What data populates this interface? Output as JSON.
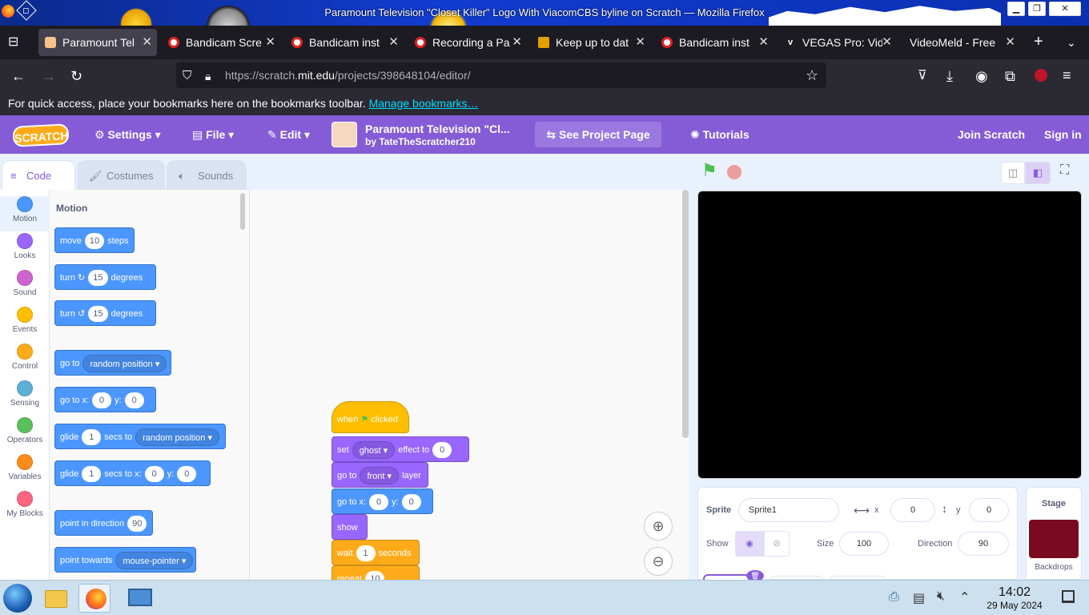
{
  "window": {
    "title": "Paramount Television \"Closet Killer\" Logo With ViacomCBS byline on Scratch — Mozilla Firefox",
    "controls": [
      "▁",
      "❐",
      "✕"
    ]
  },
  "tabs": [
    {
      "label": "Paramount Tel",
      "active": true
    },
    {
      "label": "Bandicam Scre"
    },
    {
      "label": "Bandicam inst"
    },
    {
      "label": "Recording a Pa"
    },
    {
      "label": "Keep up to dat"
    },
    {
      "label": "Bandicam inst"
    },
    {
      "label": "VEGAS Pro: Vid"
    },
    {
      "label": "VideoMeld - Free"
    }
  ],
  "url": {
    "prefix": "https://scratch.",
    "domain": "mit.edu",
    "path": "/projects/398648104/editor/"
  },
  "bookmarks": {
    "text": "For quick access, place your bookmarks here on the bookmarks toolbar.",
    "link": "Manage bookmarks…"
  },
  "menu": {
    "logo": "SCRATCH",
    "settings": "Settings",
    "file": "File",
    "edit": "Edit",
    "project_title": "Paramount Television \"Cl...",
    "author": "by TateTheScratcher210",
    "see_project": "See Project Page",
    "tutorials": "Tutorials",
    "join": "Join Scratch",
    "signin": "Sign in"
  },
  "editor_tabs": {
    "code": "Code",
    "costumes": "Costumes",
    "sounds": "Sounds"
  },
  "categories": [
    {
      "label": "Motion",
      "color": "#4c97ff"
    },
    {
      "label": "Looks",
      "color": "#9966ff"
    },
    {
      "label": "Sound",
      "color": "#cf63cf"
    },
    {
      "label": "Events",
      "color": "#ffbf00"
    },
    {
      "label": "Control",
      "color": "#ffab19"
    },
    {
      "label": "Sensing",
      "color": "#5cb1d6"
    },
    {
      "label": "Operators",
      "color": "#59c059"
    },
    {
      "label": "Variables",
      "color": "#ff8c1a"
    },
    {
      "label": "My Blocks",
      "color": "#ff6680"
    }
  ],
  "palette": {
    "heading": "Motion",
    "move": {
      "a": "move",
      "v": "10",
      "b": "steps"
    },
    "turn_cw": {
      "a": "turn",
      "v": "15",
      "b": "degrees"
    },
    "turn_ccw": {
      "a": "turn",
      "v": "15",
      "b": "degrees"
    },
    "goto": {
      "a": "go to",
      "dd": "random position"
    },
    "gotoxy": {
      "a": "go to x:",
      "x": "0",
      "b": "y:",
      "y": "0"
    },
    "glide1": {
      "a": "glide",
      "v": "1",
      "b": "secs to",
      "dd": "random position"
    },
    "glide2": {
      "a": "glide",
      "v": "1",
      "b": "secs to x:",
      "x": "0",
      "c": "y:",
      "y": "0"
    },
    "point": {
      "a": "point in direction",
      "v": "90"
    },
    "towards": {
      "a": "point towards",
      "dd": "mouse-pointer"
    }
  },
  "script": {
    "hat": {
      "a": "when",
      "b": "clicked"
    },
    "ghost": {
      "a": "set",
      "dd": "ghost",
      "b": "effect to",
      "v": "0"
    },
    "front": {
      "a": "go to",
      "dd": "front",
      "b": "layer"
    },
    "gotoxy": {
      "a": "go to x:",
      "x": "0",
      "b": "y:",
      "y": "0"
    },
    "show": {
      "a": "show"
    },
    "wait": {
      "a": "wait",
      "v": "1",
      "b": "seconds"
    },
    "repeat": {
      "a": "repeat",
      "v": "10"
    }
  },
  "sprite": {
    "label": "Sprite",
    "name": "Sprite1",
    "x_label": "x",
    "x": "0",
    "y_label": "y",
    "y": "0",
    "show_label": "Show",
    "size_label": "Size",
    "size": "100",
    "direction_label": "Direction",
    "direction": "90"
  },
  "stage_pane": {
    "label": "Stage",
    "backdrops": "Backdrops",
    "thumb_color": "#7a0a20"
  },
  "taskbar": {
    "time": "14:02",
    "date": "29 May 2024"
  }
}
